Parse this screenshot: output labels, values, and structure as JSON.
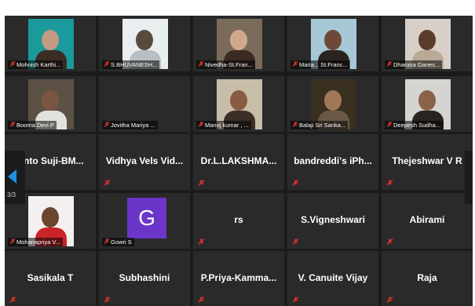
{
  "participants": [
    {
      "name": "Mohnish Karthi...",
      "type": "video"
    },
    {
      "name": "S.BHUVANESH...",
      "type": "video"
    },
    {
      "name": "Nivedha-St.Fran...",
      "type": "video"
    },
    {
      "name": "Maria... St.Franc...",
      "type": "video"
    },
    {
      "name": "Dharuna Ganes...",
      "type": "video"
    },
    {
      "name": "Booma Devi P",
      "type": "video"
    },
    {
      "name": "Jovitha Mariya ...",
      "type": "video"
    },
    {
      "name": "Manoj kumar , ...",
      "type": "video"
    },
    {
      "name": "Balaji Sri Sanka...",
      "type": "video"
    },
    {
      "name": "Deepesh Sudha...",
      "type": "video"
    },
    {
      "name": "Anto Suji-BM...",
      "type": "name"
    },
    {
      "name": "Vidhya Vels Vid...",
      "type": "name"
    },
    {
      "name": "Dr.L.LAKSHMA...",
      "type": "name"
    },
    {
      "name": "bandreddi's iPh...",
      "type": "name"
    },
    {
      "name": "Thejeshwar V R",
      "type": "name"
    },
    {
      "name": "Mohanapriya V...",
      "type": "video"
    },
    {
      "name": "Gowri S",
      "type": "avatar",
      "initial": "G"
    },
    {
      "name": "rs",
      "type": "name"
    },
    {
      "name": "S.Vigneshwari",
      "type": "name"
    },
    {
      "name": "Abirami",
      "type": "name"
    },
    {
      "name": "Sasikala T",
      "type": "name"
    },
    {
      "name": "Subhashini",
      "type": "name"
    },
    {
      "name": "P.Priya-Kamma...",
      "type": "name"
    },
    {
      "name": "V. Canuite Vijay",
      "type": "name"
    },
    {
      "name": "Raja",
      "type": "name"
    }
  ],
  "pager": {
    "page": "3/3"
  },
  "colors": {
    "muted_mic": "#e0302a",
    "nav_arrow": "#1e8fe0",
    "avatar_bg": "#6b35c9"
  }
}
